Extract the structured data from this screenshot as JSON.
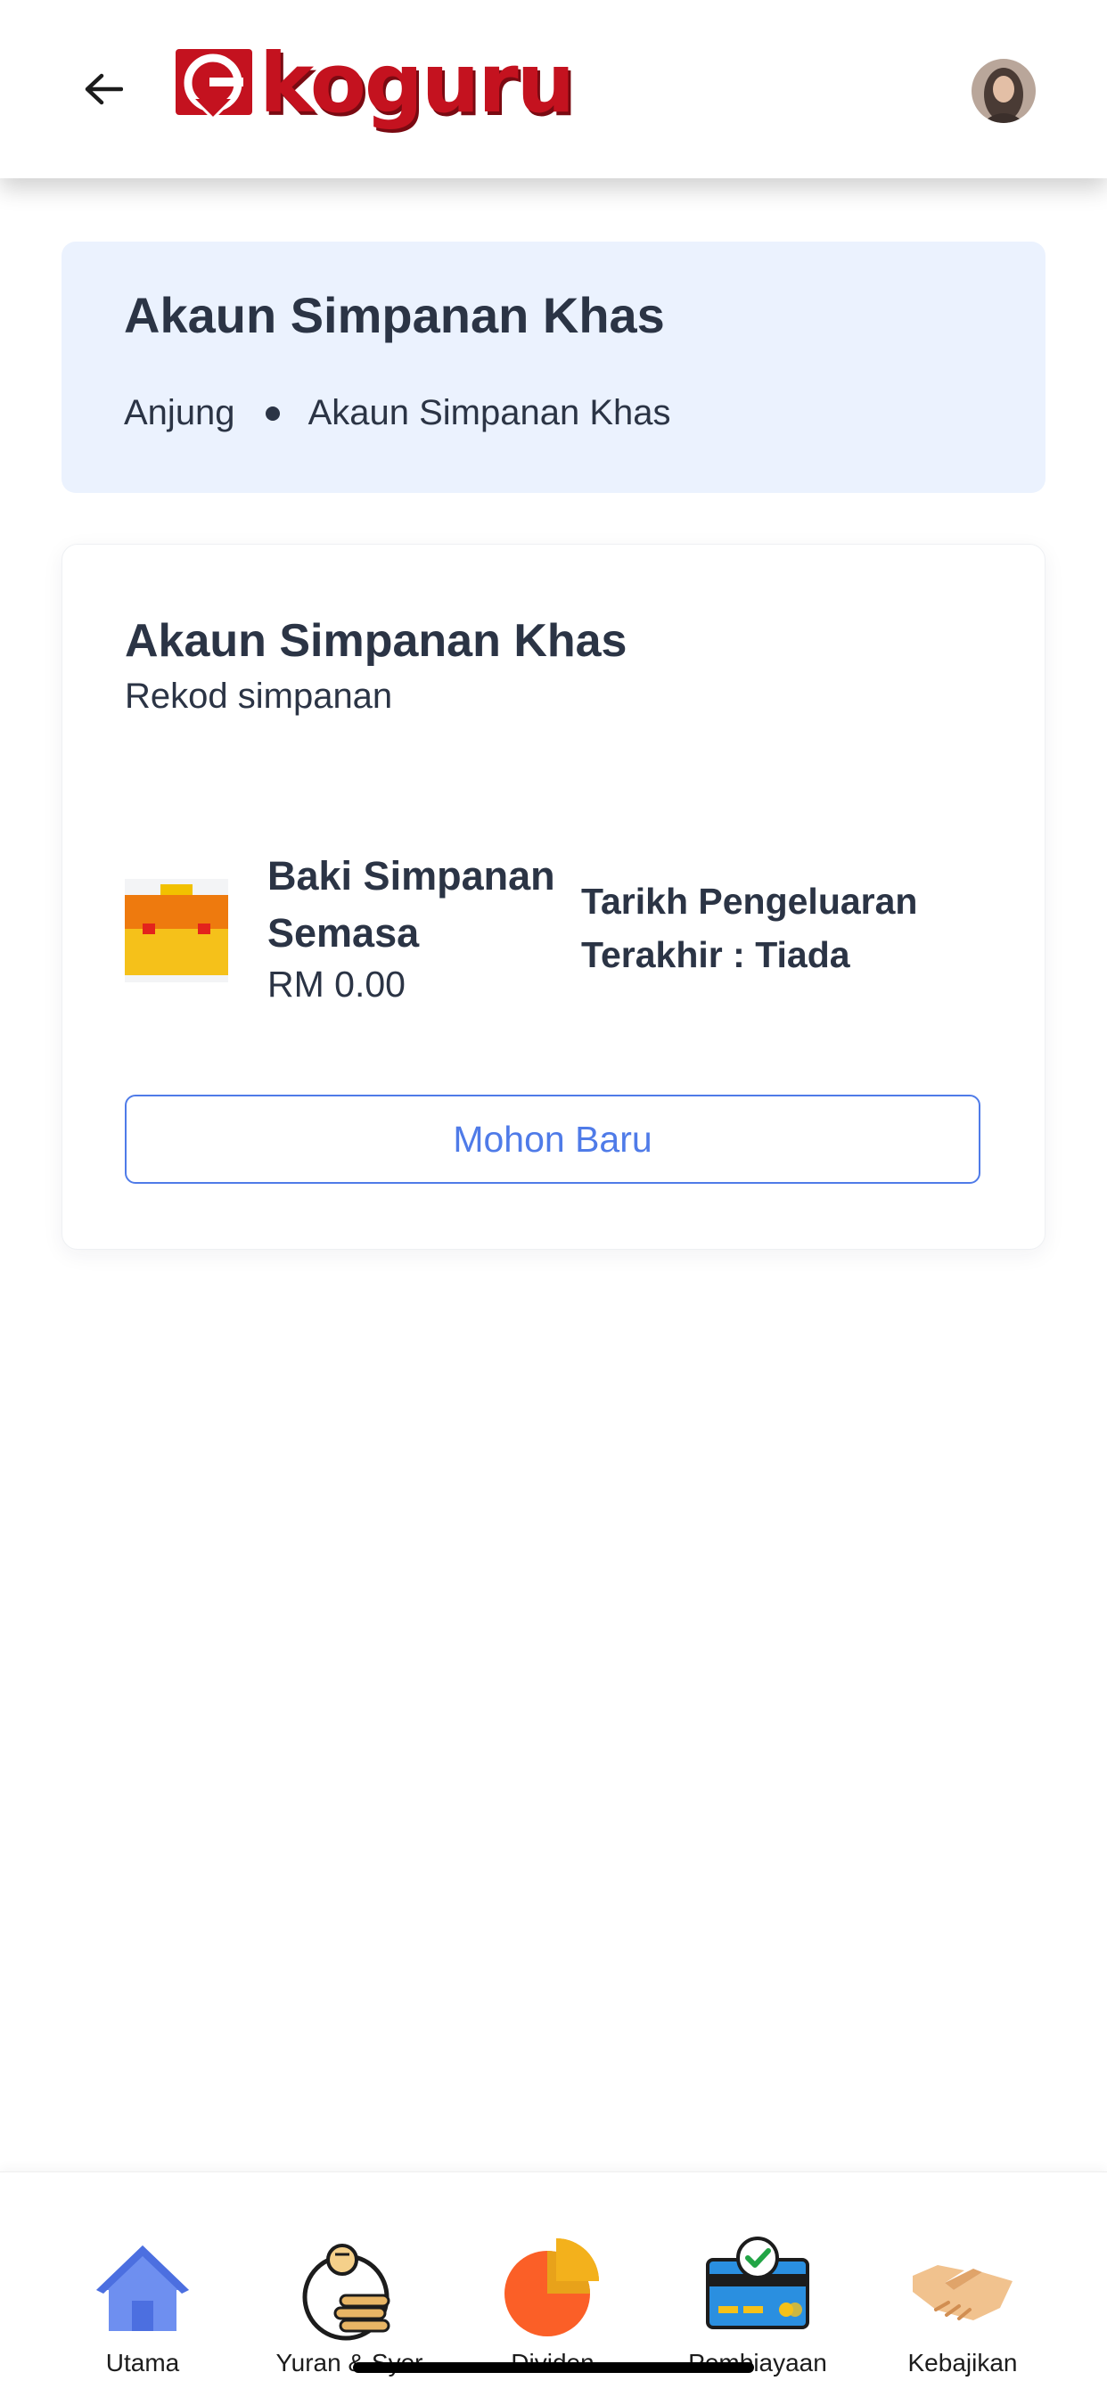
{
  "header": {
    "logo_text": "koguru",
    "back_icon": "arrow-left-icon",
    "avatar_icon": "user-avatar"
  },
  "breadcrumb": {
    "title": "Akaun Simpanan Khas",
    "home": "Anjung",
    "current": "Akaun Simpanan Khas"
  },
  "card": {
    "title": "Akaun Simpanan Khas",
    "subtitle": "Rekod simpanan",
    "balance_label": "Baki Simpanan Semasa",
    "balance_value": "RM 0.00",
    "withdrawal_label": "Tarikh Pengeluaran Terakhir : Tiada",
    "apply_button": "Mohon Baru",
    "wallet_icon": "wallet-icon"
  },
  "nav": {
    "items": [
      {
        "label": "Utama",
        "icon": "home-icon"
      },
      {
        "label": "Yuran & Syer",
        "icon": "coins-icon"
      },
      {
        "label": "Dividen",
        "icon": "pie-chart-icon"
      },
      {
        "label": "Pembiayaan",
        "icon": "credit-card-icon"
      },
      {
        "label": "Kebajikan",
        "icon": "handshake-icon"
      }
    ]
  },
  "colors": {
    "accent": "#4f7be8",
    "brand": "#c4121f",
    "crumb_bg": "#ebf2fe",
    "text": "#2b3445"
  }
}
